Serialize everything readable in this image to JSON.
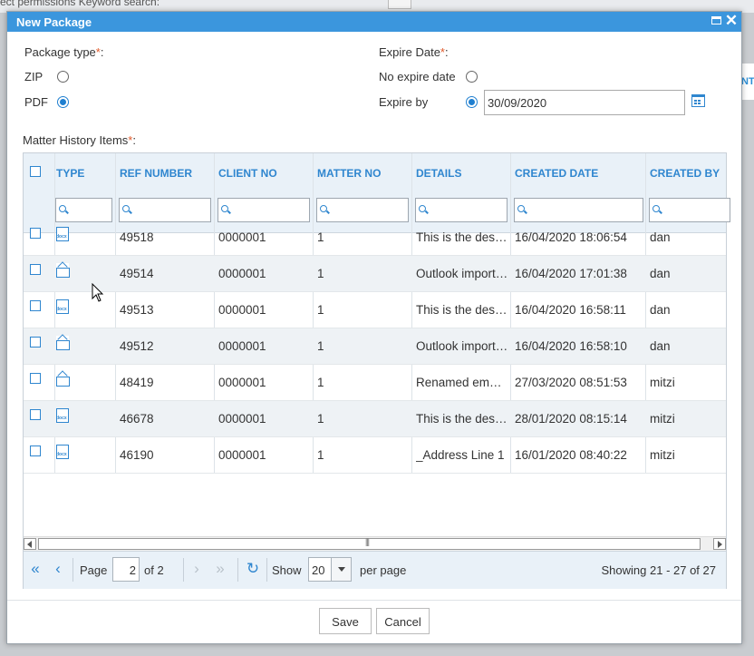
{
  "background": {
    "text": "ect permissions    Keyword search:",
    "right_fragment": "NT"
  },
  "dialog": {
    "title": "New Package"
  },
  "package_type": {
    "label": "Package type",
    "required": "*",
    "colon": ":",
    "options": [
      {
        "label": "ZIP",
        "selected": false
      },
      {
        "label": "PDF",
        "selected": true
      }
    ]
  },
  "expire": {
    "label": "Expire Date",
    "required": "*",
    "colon": ":",
    "no_expire_label": "No expire date",
    "no_expire_selected": false,
    "expire_by_label": "Expire by",
    "expire_by_selected": true,
    "date_value": "30/09/2020"
  },
  "matter_history": {
    "label": "Matter History Items",
    "required": "*",
    "colon": ":"
  },
  "grid": {
    "columns": [
      "TYPE",
      "REF NUMBER",
      "CLIENT NO",
      "MATTER NO",
      "DETAILS",
      "CREATED DATE",
      "CREATED BY"
    ],
    "rows": [
      {
        "type": "docx-icon",
        "ref": "49518",
        "client": "0000001",
        "matter": "1",
        "details": "This is the description",
        "created": "16/04/2020 18:06:54",
        "by": "dan"
      },
      {
        "type": "email-icon",
        "ref": "49514",
        "client": "0000001",
        "matter": "1",
        "details": "Outlook imported email",
        "created": "16/04/2020 17:01:38",
        "by": "dan"
      },
      {
        "type": "docx-icon",
        "ref": "49513",
        "client": "0000001",
        "matter": "1",
        "details": "This is the description",
        "created": "16/04/2020 16:58:11",
        "by": "dan"
      },
      {
        "type": "email-icon",
        "ref": "49512",
        "client": "0000001",
        "matter": "1",
        "details": "Outlook imported email",
        "created": "16/04/2020 16:58:10",
        "by": "dan"
      },
      {
        "type": "email-icon",
        "ref": "48419",
        "client": "0000001",
        "matter": "1",
        "details": "Renamed email subject",
        "created": "27/03/2020 08:51:53",
        "by": "mitzi"
      },
      {
        "type": "docx-icon",
        "ref": "46678",
        "client": "0000001",
        "matter": "1",
        "details": "This is the description",
        "created": "28/01/2020 08:15:14",
        "by": "mitzi"
      },
      {
        "type": "doc-icon",
        "ref": "46190",
        "client": "0000001",
        "matter": "1",
        "details": "_Address Line 1",
        "created": "16/01/2020 08:40:22",
        "by": "mitzi"
      }
    ]
  },
  "pager": {
    "page_label": "Page",
    "page_value": "2",
    "of_label": "of 2",
    "show_label": "Show",
    "page_size": "20",
    "per_page_label": "per page",
    "summary": "Showing 21 - 27 of 27"
  },
  "buttons": {
    "save": "Save",
    "cancel": "Cancel"
  },
  "colors": {
    "accent": "#2f86cf",
    "titlebar": "#3b96dd",
    "required": "#e05a2b"
  }
}
